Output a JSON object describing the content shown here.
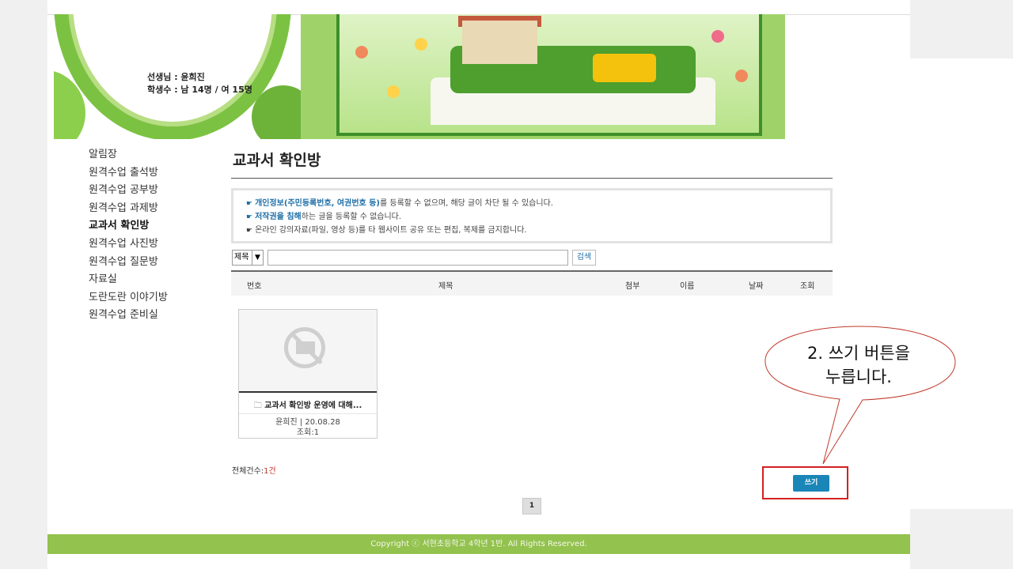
{
  "header": {
    "teacher_line": "선생님 : 윤희진",
    "students_line": "학생수 : 남 14명 / 여 15명"
  },
  "sidebar": {
    "items": [
      {
        "label": "알림장",
        "active": false
      },
      {
        "label": "원격수업 출석방",
        "active": false
      },
      {
        "label": "원격수업 공부방",
        "active": false
      },
      {
        "label": "원격수업 과제방",
        "active": false
      },
      {
        "label": "교과서 확인방",
        "active": true
      },
      {
        "label": "원격수업 사진방",
        "active": false
      },
      {
        "label": "원격수업 질문방",
        "active": false
      },
      {
        "label": "자료실",
        "active": false
      },
      {
        "label": "도란도란 이야기방",
        "active": false
      },
      {
        "label": "원격수업 준비실",
        "active": false
      }
    ]
  },
  "main": {
    "title": "교과서 확인방",
    "notice": {
      "line1_hl": "개인정보(주민등록번호, 여권번호 등)",
      "line1_rest": "를 등록할 수 없으며, 해당 글이 차단 될 수 있습니다.",
      "line2_hl": "저작권을 침해",
      "line2_rest": "하는 글을 등록할 수 없습니다.",
      "line3": "온라인 강의자료(파일, 영상 등)를 타 웹사이트 공유 또는 편집, 복제를 금지합니다."
    },
    "search": {
      "select_value": "제목",
      "input_value": "",
      "button_label": "검색"
    },
    "table_headers": [
      "번호",
      "제목",
      "첨부",
      "이름",
      "날짜",
      "조회"
    ],
    "post": {
      "title": "교과서 확인방 운영에 대해...",
      "author_date": "윤희진 | 20.08.28",
      "views": "조회:1"
    },
    "total_label": "전체건수:",
    "total_count": "1건",
    "write_button": "쓰기",
    "page": "1"
  },
  "footer": {
    "text": "Copyright ⓒ 서현초등학교 4학년 1반. All Rights Reserved."
  },
  "callout": {
    "line1": "2.  쓰기  버튼을",
    "line2": "누릅니다."
  },
  "colors": {
    "accent_green": "#93c24e",
    "button_blue": "#1a86b8",
    "highlight_red": "#d42020",
    "link_blue": "#1f6fa8"
  }
}
